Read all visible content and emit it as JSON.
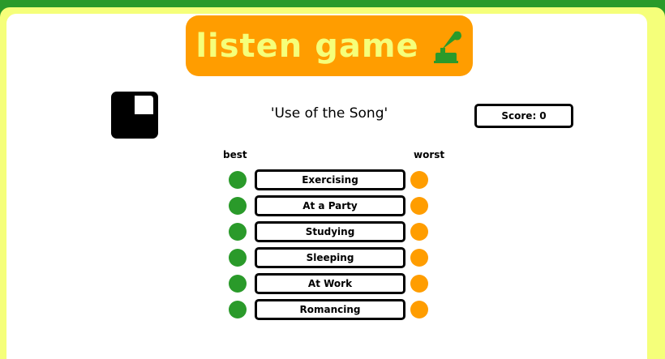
{
  "header": {
    "title": "listen game",
    "icon": "gramophone-icon",
    "brand_colors": {
      "green": "#2a9a2a",
      "orange": "#ff9d00",
      "yellow": "#f5ff7a"
    }
  },
  "game": {
    "timer_icon": "clock-icon",
    "prompt": "'Use of the Song'",
    "score_label": "Score:",
    "score_value": "0"
  },
  "ranking": {
    "best_label": "best",
    "worst_label": "worst",
    "items": [
      {
        "label": "Exercising"
      },
      {
        "label": "At a Party"
      },
      {
        "label": "Studying"
      },
      {
        "label": "Sleeping"
      },
      {
        "label": "At Work"
      },
      {
        "label": "Romancing"
      }
    ]
  }
}
